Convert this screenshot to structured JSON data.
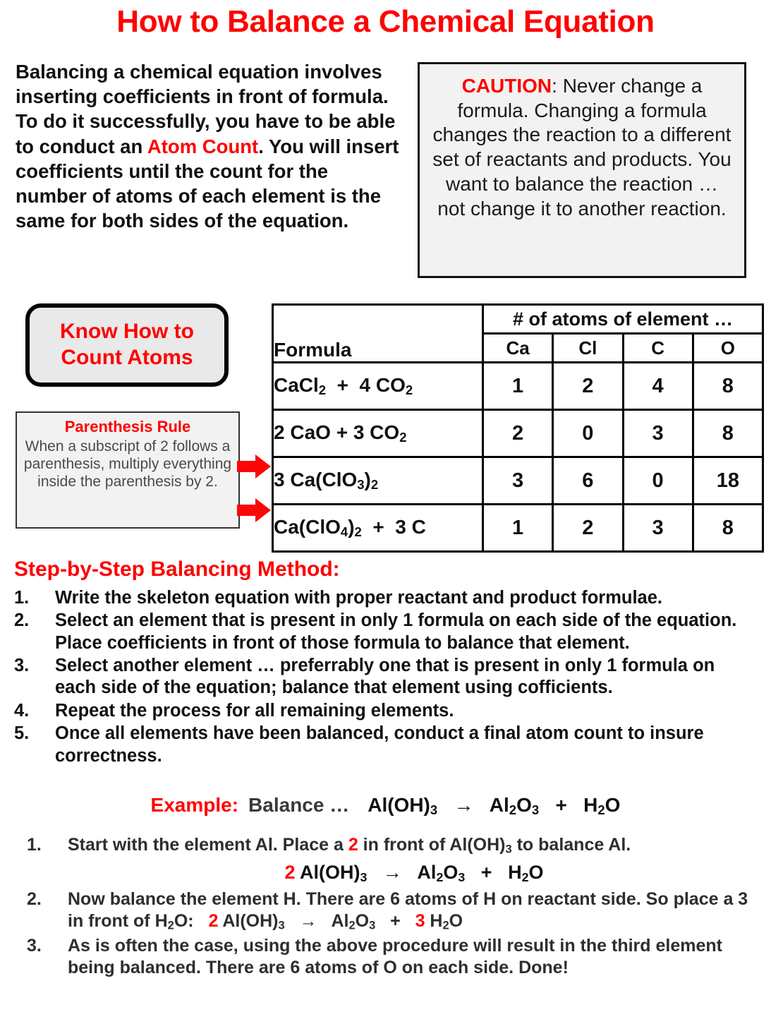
{
  "title": "How to Balance a Chemical Equation",
  "intro": {
    "part1": "Balancing a chemical equation involves inserting coefficients in front of formula. To do it successfully, you have to be able to conduct an ",
    "highlight": "Atom Count",
    "part2": ". You will insert coefficients until the count for the number of atoms of each element is the same for both sides of the equation."
  },
  "caution": {
    "label": "CAUTION",
    "text": ": Never change a formula. Changing a formula changes the reaction to a different set of reactants and products. You want to balance the reaction … not change it to another reaction."
  },
  "know_box": {
    "line1": "Know How to",
    "line2": "Count Atoms"
  },
  "paren_rule": {
    "title": "Parenthesis Rule",
    "body": "When a subscript of 2 follows a parenthesis, multiply everything inside the parenthesis by 2."
  },
  "table": {
    "span_header": "# of atoms of element …",
    "formula_header": "Formula",
    "element_headers": [
      "Ca",
      "Cl",
      "C",
      "O"
    ],
    "rows": [
      {
        "formula_html": "CaCl<sub>2</sub> &nbsp;+ &nbsp;4 CO<sub>2</sub>",
        "values": [
          "1",
          "2",
          "4",
          "8"
        ]
      },
      {
        "formula_html": "2 CaO + 3 CO<sub>2</sub>",
        "values": [
          "2",
          "0",
          "3",
          "8"
        ]
      },
      {
        "formula_html": "3 Ca(ClO<sub>3</sub>)<sub>2</sub>",
        "values": [
          "3",
          "6",
          "0",
          "18"
        ]
      },
      {
        "formula_html": "Ca(ClO<sub>4</sub>)<sub>2</sub> &nbsp;+ &nbsp;3 C",
        "values": [
          "1",
          "2",
          "3",
          "8"
        ]
      }
    ]
  },
  "steps_section": {
    "heading": "Step-by-Step Balancing Method:",
    "items": [
      {
        "num": "1.",
        "text": "Write the skeleton equation with proper reactant and product formulae."
      },
      {
        "num": "2.",
        "text": "Select an element that is present in only 1 formula on each side of the equation. Place coefficients in front of those formula to balance that element."
      },
      {
        "num": "3.",
        "text": "Select another element … preferrably one that is present in only 1 formula on each side of the equation; balance that element using cofficients."
      },
      {
        "num": "4.",
        "text": "Repeat the process for all remaining elements."
      },
      {
        "num": "5.",
        "text": "Once all elements have been balanced, conduct a final atom count to insure correctness."
      }
    ]
  },
  "example": {
    "label": "Example:",
    "balance_word": "Balance …",
    "equation_html": "Al(OH)<sub>3</sub> &nbsp; → &nbsp; Al<sub>2</sub>O<sub>3</sub> &nbsp; + &nbsp; H<sub>2</sub>O",
    "steps": [
      {
        "num": "1.",
        "text_html": "Start with the element Al. Place a <span class=\"red\">2</span> in front of Al(OH)<sub>3</sub> to balance Al.",
        "equation_html": "<span class=\"red\">2</span> Al(OH)<sub>3</sub> &nbsp; → &nbsp; Al<sub>2</sub>O<sub>3</sub> &nbsp; + &nbsp; H<sub>2</sub>O"
      },
      {
        "num": "2.",
        "text_html": "Now balance the element H. There are 6 atoms of H on reactant side. So place a 3 in front of H<sub>2</sub>O: &nbsp; <span class=\"red\">2</span> Al(OH)<sub>3</sub> &nbsp; → &nbsp; Al<sub>2</sub>O<sub>3</sub> &nbsp; + &nbsp; <span class=\"red\">3</span> H<sub>2</sub>O",
        "equation_html": ""
      },
      {
        "num": "3.",
        "text_html": "As is often the case, using the above procedure will result in the third element being balanced. There are 6 atoms of O on each side. Done!",
        "equation_html": ""
      }
    ]
  },
  "colors": {
    "accent_red": "#ff0000",
    "arrow_red": "#fb0707",
    "body_black": "#111111",
    "gray_text": "#3a3a3a",
    "box_bg": "#f2f2f2"
  }
}
